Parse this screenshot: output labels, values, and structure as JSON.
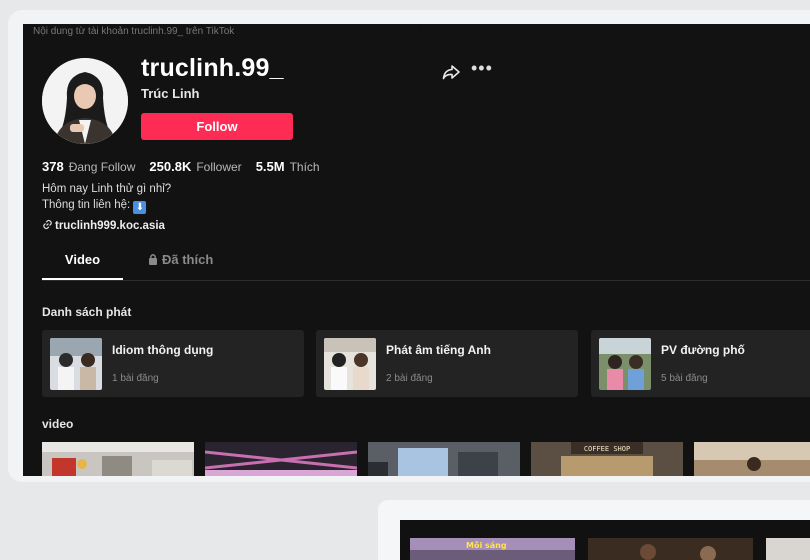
{
  "profile": {
    "top_line": "Nội dung từ tài khoản truclinh.99_ trên TikTok",
    "username": "truclinh.99_",
    "display_name": "Trúc Linh",
    "follow_label": "Follow",
    "stats": {
      "following_value": "378",
      "following_label": "Đang Follow",
      "followers_value": "250.8K",
      "followers_label": "Follower",
      "likes_value": "5.5M",
      "likes_label": "Thích"
    },
    "bio_line1": "Hôm nay Linh thử gì nhỉ?",
    "bio_line2": "Thông tin liên hệ:",
    "link": "truclinh999.koc.asia"
  },
  "tabs": {
    "video": "Video",
    "liked": "Đã thích"
  },
  "playlists": {
    "title": "Danh sách phát",
    "items": [
      {
        "title": "Idiom thông dụng",
        "count": "1 bài đăng"
      },
      {
        "title": "Phát âm tiếng Anh",
        "count": "2 bài đăng"
      },
      {
        "title": "PV đường phố",
        "count": "5 bài đăng"
      }
    ]
  },
  "videos": {
    "title": "video",
    "thumb_texts": [
      "COFFEE SHOP"
    ],
    "lower_thumb_texts": [
      "Mỗi sáng"
    ]
  },
  "icons": [
    "share-icon",
    "more-icon",
    "lock-icon",
    "link-icon",
    "down-arrow-emoji-icon"
  ],
  "colors": {
    "accent": "#fe2c55",
    "background": "#121212",
    "card": "#232323"
  }
}
